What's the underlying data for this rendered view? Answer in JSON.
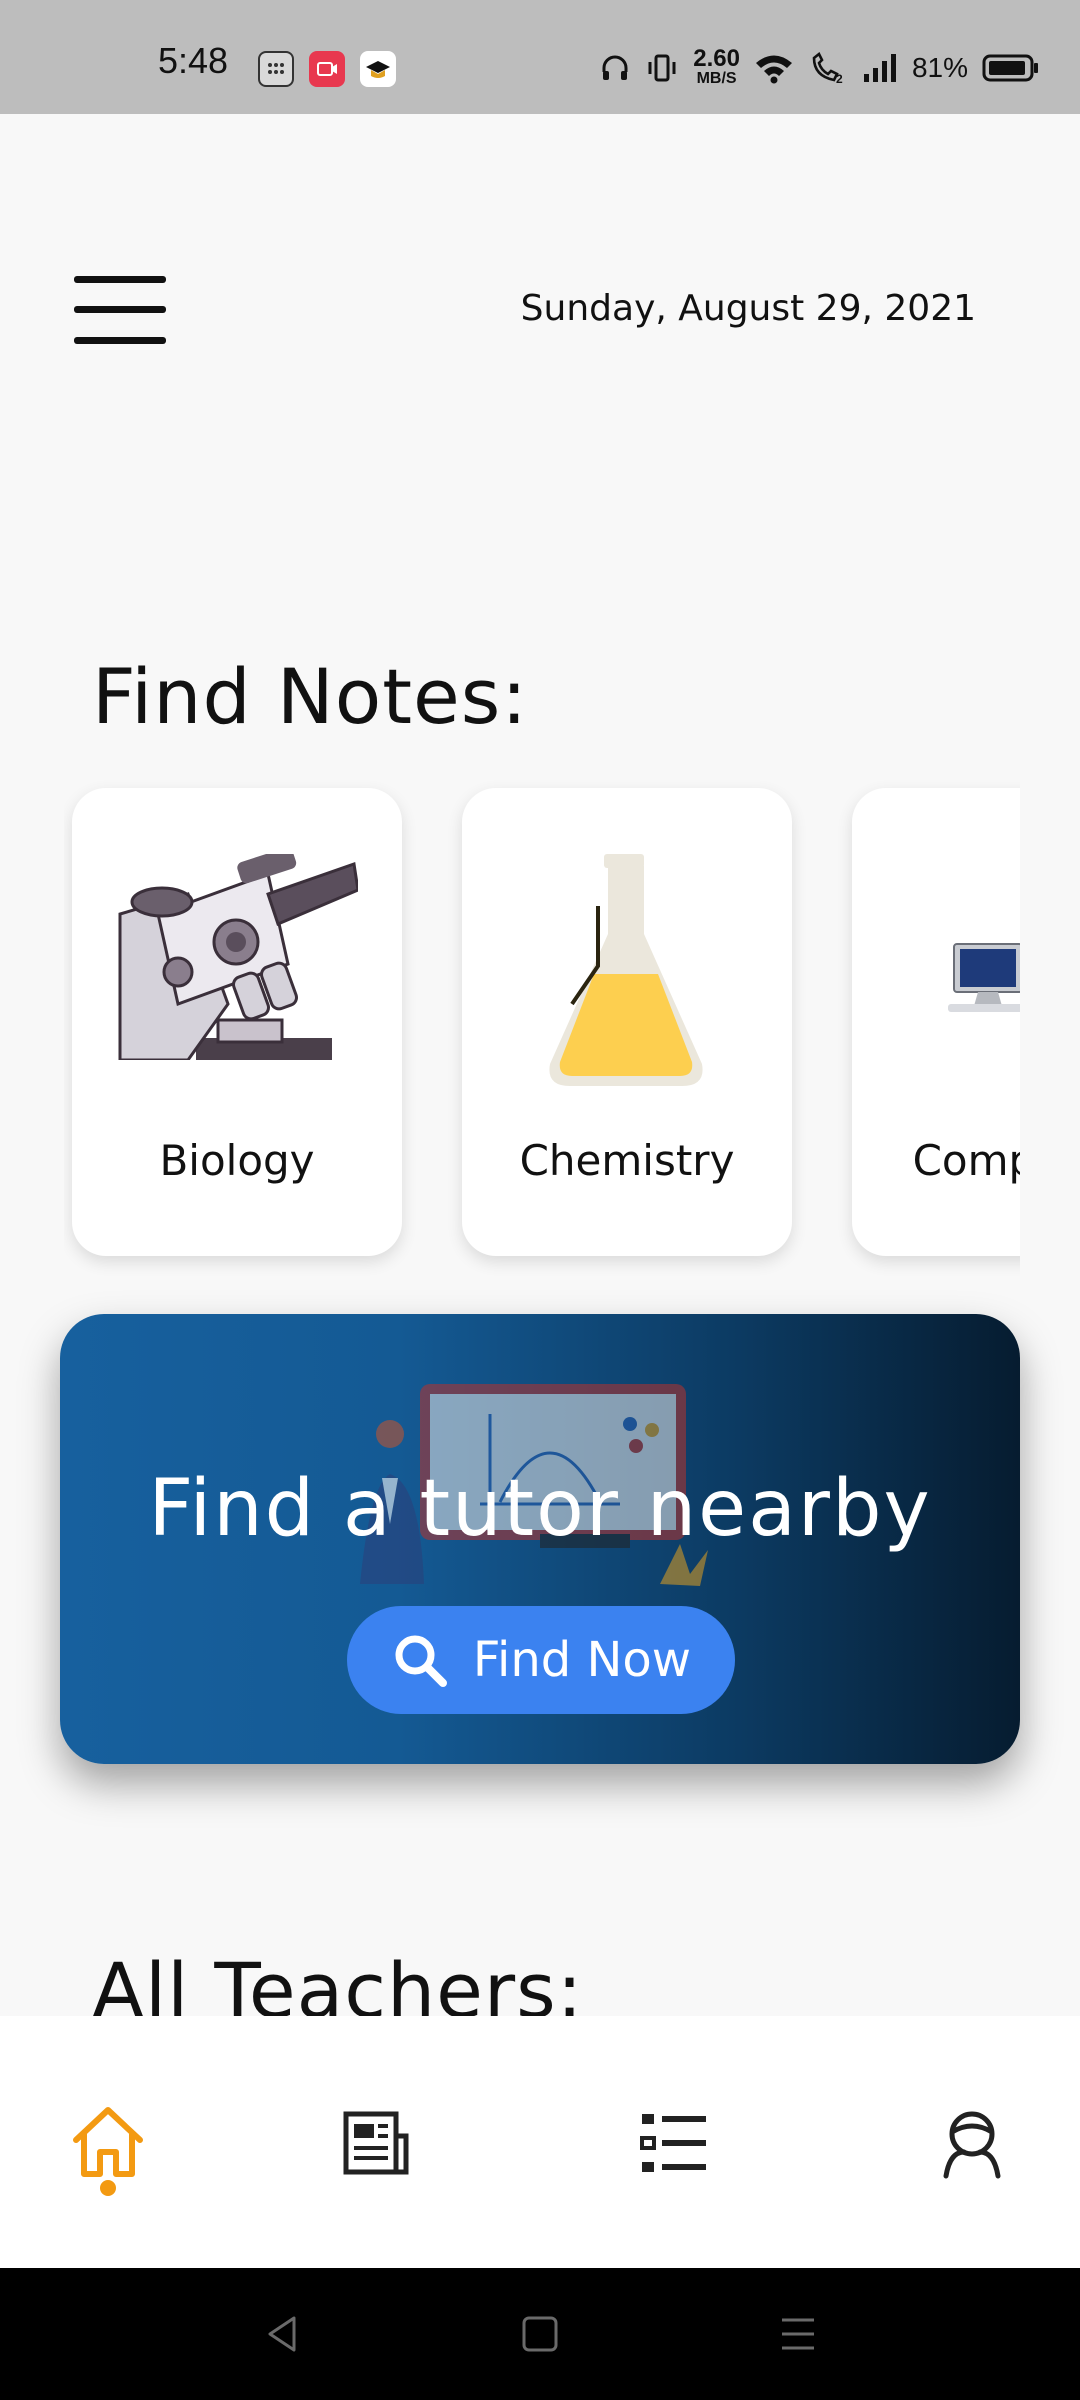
{
  "status_bar": {
    "time": "5:48",
    "speed_value": "2.60",
    "speed_unit": "MB/S",
    "battery": "81%",
    "icons": [
      "calculator-icon",
      "screen-recorder-icon",
      "graduation-cap-icon",
      "headphones-icon",
      "vibrate-icon",
      "wifi-icon",
      "wifi-call-icon",
      "signal-icon",
      "battery-icon"
    ]
  },
  "header": {
    "date": "Sunday, August 29, 2021"
  },
  "notes": {
    "title": "Find Notes:",
    "subjects": [
      {
        "label": "Biology",
        "icon": "microscope-icon"
      },
      {
        "label": "Chemistry",
        "icon": "flask-icon"
      },
      {
        "label": "Computer",
        "icon": "computer-icon"
      }
    ]
  },
  "tutor_banner": {
    "title": "Find a tutor nearby",
    "button_label": "Find Now",
    "button_icon": "search-icon"
  },
  "teachers": {
    "title": "All Teachers:"
  },
  "bottom_nav": {
    "items": [
      "home-icon",
      "news-icon",
      "list-icon",
      "user-icon"
    ],
    "active": "home-icon",
    "active_color": "#f39a12"
  },
  "system_nav": [
    "back-icon",
    "home-square-icon",
    "recents-icon"
  ]
}
